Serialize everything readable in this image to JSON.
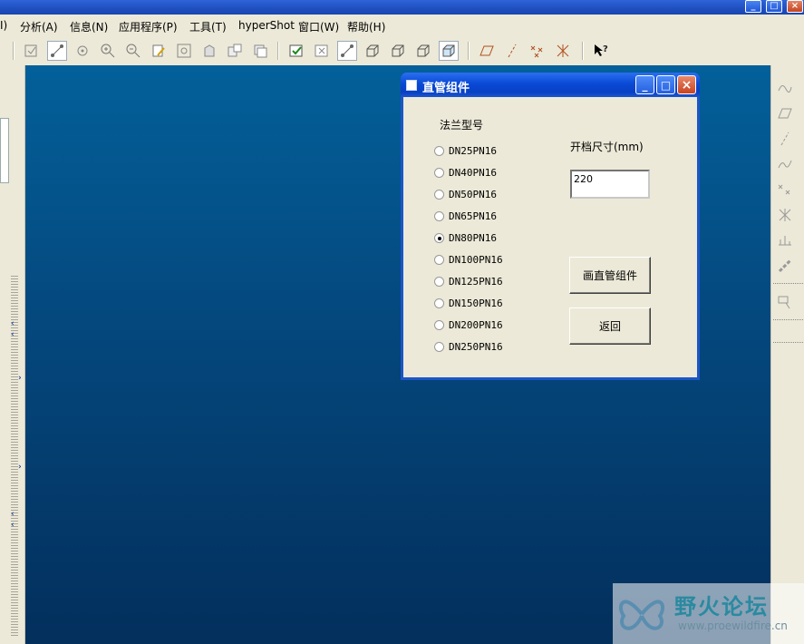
{
  "menubar": {
    "items": [
      {
        "label": "I)"
      },
      {
        "label": "分析(A)"
      },
      {
        "label": "信息(N)"
      },
      {
        "label": "应用程序(P)"
      },
      {
        "label": "工具(T)"
      },
      {
        "label": "hyperShot"
      },
      {
        "label": "窗口(W)"
      },
      {
        "label": "帮助(H)"
      }
    ]
  },
  "dialog": {
    "title": "直管组件",
    "flange_label": "法兰型号",
    "options": [
      {
        "label": "DN25PN16",
        "checked": false
      },
      {
        "label": "DN40PN16",
        "checked": false
      },
      {
        "label": "DN50PN16",
        "checked": false
      },
      {
        "label": "DN65PN16",
        "checked": false
      },
      {
        "label": "DN80PN16",
        "checked": true
      },
      {
        "label": "DN100PN16",
        "checked": false
      },
      {
        "label": "DN125PN16",
        "checked": false
      },
      {
        "label": "DN150PN16",
        "checked": false
      },
      {
        "label": "DN200PN16",
        "checked": false
      },
      {
        "label": "DN250PN16",
        "checked": false
      }
    ],
    "size_label": "开档尺寸(mm)",
    "size_value": "220",
    "draw_button": "画直管组件",
    "back_button": "返回"
  },
  "watermark": {
    "brand": "野火论坛",
    "url": "www.proewildfire.cn"
  },
  "colors": {
    "viewport_top": "#03609a",
    "viewport_bottom": "#032f5c",
    "titlebar": "#0a4ad6"
  }
}
